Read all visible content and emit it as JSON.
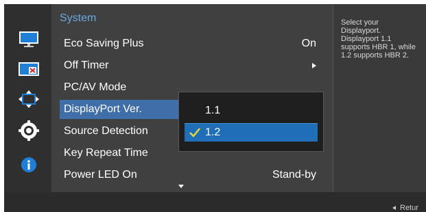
{
  "header": {
    "section_title": "System"
  },
  "menu": {
    "items": [
      {
        "label": "Eco Saving Plus",
        "value": "On"
      },
      {
        "label": "Off Timer",
        "value": ""
      },
      {
        "label": "PC/AV Mode",
        "value": ""
      },
      {
        "label": "DisplayPort Ver.",
        "value": ""
      },
      {
        "label": "Source Detection",
        "value": ""
      },
      {
        "label": "Key Repeat Time",
        "value": ""
      },
      {
        "label": "Power LED On",
        "value": "Stand-by"
      }
    ]
  },
  "dropdown": {
    "options": [
      "1.1",
      "1.2"
    ]
  },
  "info": {
    "text": "Select your Displayport. Displayport 1.1 supports HBR 1, while 1.2 supports HBR 2."
  },
  "footer": {
    "return_label": "Retur"
  },
  "colors": {
    "accent_blue": "#1f6eb7",
    "title_blue": "#69a7e0",
    "selection_blue": "#3f6ea8",
    "check_yellow": "#e5d93a"
  },
  "icons": [
    "monitor-icon",
    "picture-in-picture-icon",
    "size-position-icon",
    "gear-icon",
    "info-icon"
  ]
}
